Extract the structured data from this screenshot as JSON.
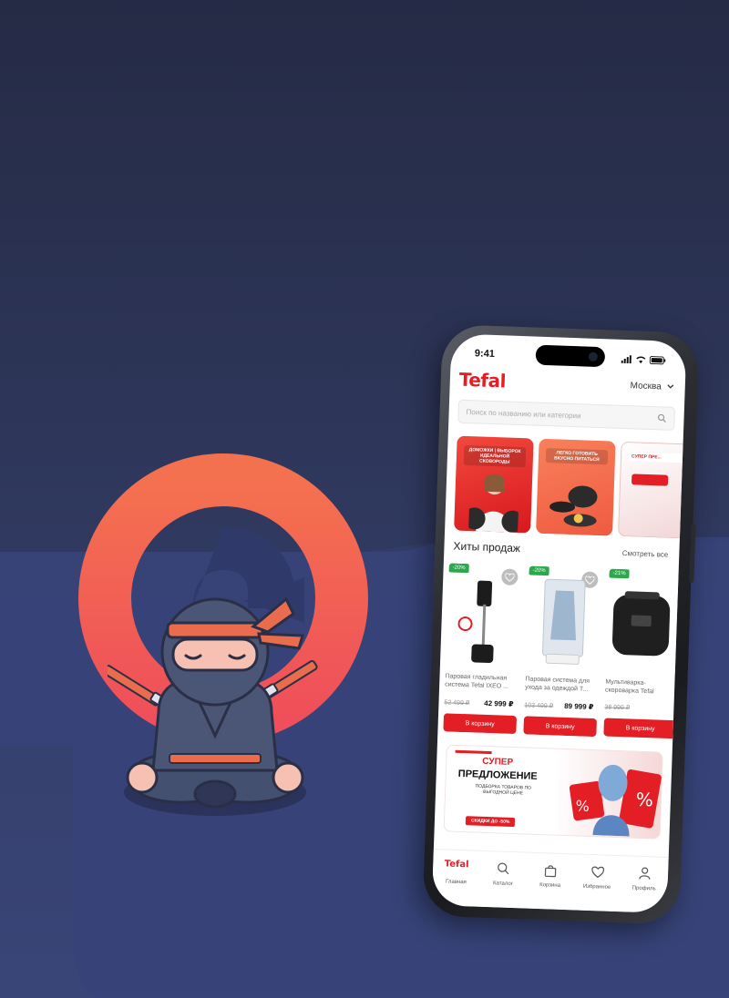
{
  "colors": {
    "background": "#2d3558",
    "band": "#3a4677",
    "logo_gradient_top": "#f4714f",
    "logo_gradient_bottom": "#ef4f5a",
    "brand_red": "#e31e24",
    "discount_green": "#2aa84a"
  },
  "status_bar": {
    "time": "9:41",
    "icons": [
      "signal-icon",
      "wifi-icon",
      "battery-icon"
    ]
  },
  "app": {
    "brand": "Tefal",
    "city": "Москва",
    "search_placeholder": "Поиск по названию или категории"
  },
  "banners": [
    {
      "tag": "ДОМОЖКИ | ВЫБОРОК ИДЕАЛЬНОЙ СКОВОРОДЫ"
    },
    {
      "tag": "ЛЕГКО ГОТОВИТЬ ВКУСНО ПИТАТЬСЯ"
    },
    {
      "tag": "СУПЕР ПРЕ..."
    }
  ],
  "hits": {
    "title": "Хиты продаж",
    "see_all": "Смотреть все",
    "products": [
      {
        "badge": "-20%",
        "name": "Паровая гладильная система Tefal IXEO ...",
        "old_price": "52 499 ₽",
        "new_price": "42 999 ₽",
        "button": "В корзину"
      },
      {
        "badge": "-20%",
        "name": "Паровая система для ухода за одеждой T...",
        "old_price": "103 499 ₽",
        "new_price": "89 999 ₽",
        "button": "В корзину"
      },
      {
        "badge": "-21%",
        "name": "Мультиварка-скороварка Tefal",
        "old_price": "38 999 ₽",
        "new_price": "",
        "button": "В корзину"
      }
    ]
  },
  "promo": {
    "line1": "СУПЕР",
    "line2": "ПРЕДЛОЖЕНИЕ",
    "line3": "ПОДБОРКА ТОВАРОВ ПО ВЫГОДНОЙ ЦЕНЕ",
    "sale": "СКИДКИ ДО -50%"
  },
  "tabbar": [
    {
      "label": "Главная",
      "icon": "brand-logo"
    },
    {
      "label": "Каталог",
      "icon": "search-icon"
    },
    {
      "label": "Корзина",
      "icon": "bag-icon"
    },
    {
      "label": "Избранное",
      "icon": "heart-icon"
    },
    {
      "label": "Профиль",
      "icon": "user-icon"
    }
  ]
}
